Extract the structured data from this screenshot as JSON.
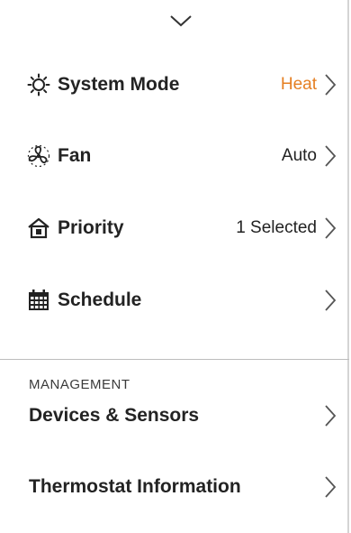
{
  "header": {
    "collapse_icon": "chevron-down-icon"
  },
  "settings": [
    {
      "id": "system-mode",
      "icon": "sun-gear-icon",
      "label": "System Mode",
      "value": "Heat",
      "value_color": "#e57f22"
    },
    {
      "id": "fan",
      "icon": "fan-icon",
      "label": "Fan",
      "value": "Auto"
    },
    {
      "id": "priority",
      "icon": "home-priority-icon",
      "label": "Priority",
      "value": "1 Selected"
    },
    {
      "id": "schedule",
      "icon": "calendar-icon",
      "label": "Schedule",
      "value": ""
    }
  ],
  "management": {
    "title": "MANAGEMENT",
    "items": [
      {
        "id": "devices-sensors",
        "label": "Devices & Sensors"
      },
      {
        "id": "thermostat-info",
        "label": "Thermostat Information"
      }
    ]
  },
  "colors": {
    "accent": "#e57f22",
    "text": "#232323",
    "divider": "#bdbdbd"
  }
}
